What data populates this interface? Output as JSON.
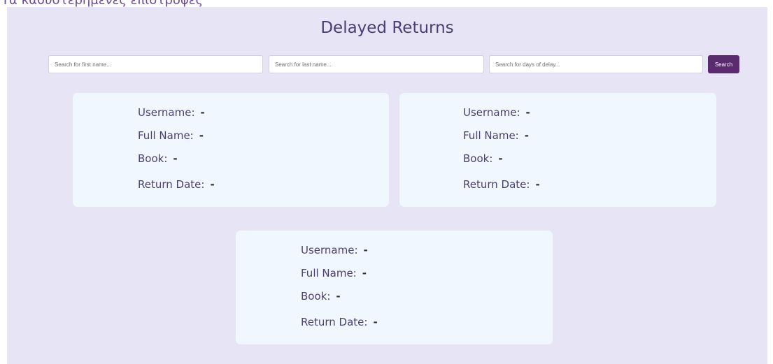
{
  "top_caption": "Τα καθυστερημένες επιστροφές",
  "title": "Delayed Returns",
  "search": {
    "first_name_placeholder": "Search for first name...",
    "last_name_placeholder": "Search for last name...",
    "days_placeholder": "Search for days of delay...",
    "button_label": "Search"
  },
  "labels": {
    "username": "Username:",
    "full_name": "Full Name:",
    "book": "Book:",
    "return_date": "Return Date:"
  },
  "records": [
    {
      "username": "-",
      "full_name": "-",
      "book": "-",
      "return_date": "-"
    },
    {
      "username": "-",
      "full_name": "-",
      "book": "-",
      "return_date": "-"
    },
    {
      "username": "-",
      "full_name": "-",
      "book": "-",
      "return_date": "-"
    }
  ],
  "colors": {
    "panel_bg": "#e7e5f5",
    "card_bg": "#f0f7ff",
    "button_bg": "#5a2b6e",
    "text": "#4b3f72"
  }
}
